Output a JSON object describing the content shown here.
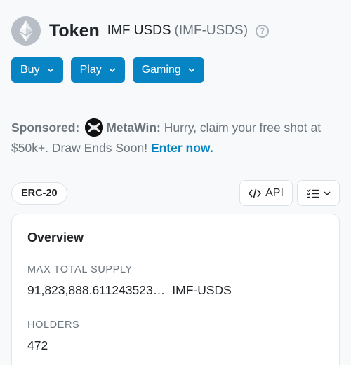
{
  "header": {
    "title": "Token",
    "token_name": "IMF USDS",
    "token_symbol": "(IMF-USDS)",
    "help_symbol": "?"
  },
  "actions": {
    "buy_label": "Buy",
    "play_label": "Play",
    "gaming_label": "Gaming"
  },
  "sponsored": {
    "label": "Sponsored:",
    "brand": "MetaWin:",
    "message": " Hurry, claim your free shot at $50k+. Draw Ends Soon! ",
    "link_text": "Enter now."
  },
  "badge": {
    "label": "ERC-20"
  },
  "toolbar": {
    "api_label": "API"
  },
  "overview": {
    "title": "Overview",
    "max_supply_label": "MAX TOTAL SUPPLY",
    "max_supply_value": "91,823,888.611243523…",
    "max_supply_unit": "IMF-USDS",
    "holders_label": "HOLDERS",
    "holders_value": "472"
  },
  "colors": {
    "accent": "#0784c3",
    "muted_text": "#6c757d",
    "page_bg": "#f8f9fa"
  },
  "icons": [
    "ethereum-icon",
    "help-icon",
    "chevron-down-icon",
    "metawin-icon",
    "code-icon",
    "list-check-icon"
  ]
}
